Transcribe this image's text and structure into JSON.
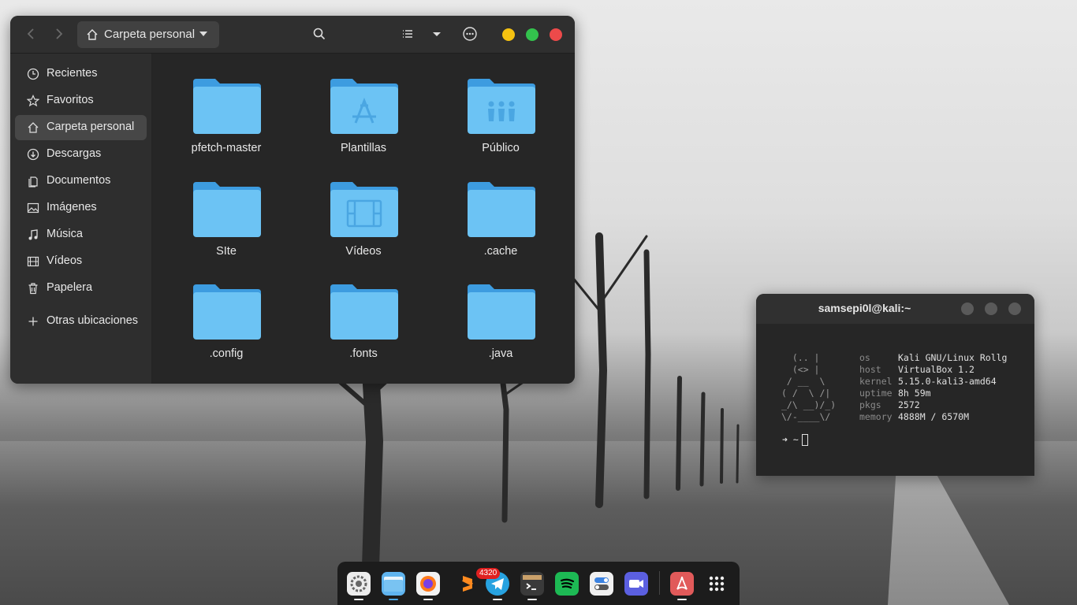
{
  "file_manager": {
    "path_label": "Carpeta personal",
    "sidebar": [
      {
        "label": "Recientes",
        "icon": "clock-icon"
      },
      {
        "label": "Favoritos",
        "icon": "star-icon"
      },
      {
        "label": "Carpeta personal",
        "icon": "home-icon",
        "active": true
      },
      {
        "label": "Descargas",
        "icon": "download-icon"
      },
      {
        "label": "Documentos",
        "icon": "document-icon"
      },
      {
        "label": "Imágenes",
        "icon": "image-icon"
      },
      {
        "label": "Música",
        "icon": "music-icon"
      },
      {
        "label": "Vídeos",
        "icon": "film-icon"
      },
      {
        "label": "Papelera",
        "icon": "trash-icon"
      },
      {
        "label": "Otras ubicaciones",
        "icon": "plus-icon"
      }
    ],
    "folders": [
      {
        "name": "pfetch-master",
        "emblem": "none"
      },
      {
        "name": "Plantillas",
        "emblem": "template-icon"
      },
      {
        "name": "Público",
        "emblem": "people-icon"
      },
      {
        "name": "SIte",
        "emblem": "none"
      },
      {
        "name": "Vídeos",
        "emblem": "film-icon"
      },
      {
        "name": ".cache",
        "emblem": "none"
      },
      {
        "name": ".config",
        "emblem": "none"
      },
      {
        "name": ".fonts",
        "emblem": "none"
      },
      {
        "name": ".java",
        "emblem": "none"
      }
    ],
    "colors": {
      "folder": "#6cc3f4",
      "folder_tab": "#3d9ce0",
      "minimize": "#f5c211",
      "maximize": "#33c24d",
      "close": "#ed4a4a"
    }
  },
  "terminal": {
    "title": "samsepi0l@kali:~",
    "ascii": [
      "  (.. |",
      "  (<> |",
      " / __  \\",
      "( /  \\ /|",
      "_/\\ __)/_)",
      "\\/-____\\/"
    ],
    "info": [
      {
        "key": "os",
        "value": "Kali GNU/Linux Rollg"
      },
      {
        "key": "host",
        "value": "VirtualBox 1.2"
      },
      {
        "key": "kernel",
        "value": "5.15.0-kali3-amd64"
      },
      {
        "key": "uptime",
        "value": "8h 59m"
      },
      {
        "key": "pkgs",
        "value": "2572"
      },
      {
        "key": "memory",
        "value": "4888M / 6570M"
      }
    ],
    "prompt": "➜  ~"
  },
  "dock": {
    "apps": [
      {
        "name": "settings-app-icon",
        "color": "#e8e8e8",
        "running": true
      },
      {
        "name": "files-app-icon",
        "color": "#5fb4ef",
        "running": true
      },
      {
        "name": "firefox-app-icon",
        "color": "#f2f2f2",
        "running": true
      },
      {
        "name": "sublime-app-icon",
        "color": "#1c1c1c",
        "running": false
      },
      {
        "name": "telegram-app-icon",
        "color": "#27a2e0",
        "running": true,
        "badge": "4320"
      },
      {
        "name": "terminal-app-icon",
        "color": "#3a3a3a",
        "running": true
      },
      {
        "name": "spotify-app-icon",
        "color": "#1db954",
        "running": false
      },
      {
        "name": "tweaks-app-icon",
        "color": "#f0f0f0",
        "running": false
      },
      {
        "name": "zoom-app-icon",
        "color": "#5b5fe0",
        "running": false
      },
      {
        "name": "pdf-app-icon",
        "color": "#e15a5a",
        "running": true
      },
      {
        "name": "app-grid-icon",
        "color": "#1c1c1c",
        "running": false
      }
    ]
  }
}
